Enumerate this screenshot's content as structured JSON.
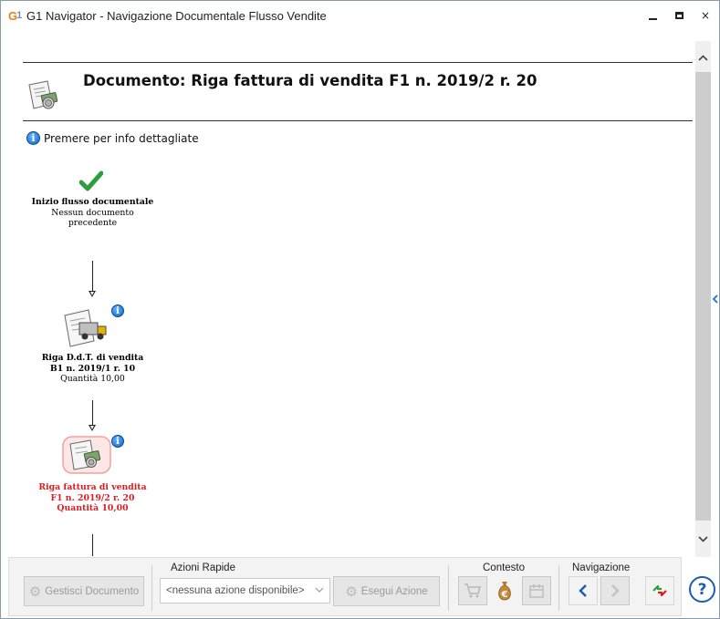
{
  "window": {
    "app_logo": "G1",
    "title": "G1 Navigator - Navigazione Documentale Flusso Vendite",
    "minimize_icon": "minimize-icon",
    "maximize_icon": "maximize-icon",
    "close_label": "×"
  },
  "header": {
    "title": "Documento: Riga fattura di vendita F1 n. 2019/2 r. 20",
    "icon": "invoice-document-icon"
  },
  "info_hint": {
    "icon_glyph": "i",
    "text": "Premere per info dettagliate"
  },
  "flow": {
    "start": {
      "icon": "checkmark-icon",
      "name": "Inizio flusso documentale",
      "lines": [
        "Nessun documento",
        "precedente"
      ]
    },
    "nodes": [
      {
        "icon": "delivery-truck-document-icon",
        "info_glyph": "i",
        "name": "Riga D.d.T. di vendita",
        "ref": "B1 n. 2019/1 r. 10",
        "qty": "Quantità 10,00",
        "current": false
      },
      {
        "icon": "invoice-document-icon",
        "info_glyph": "i",
        "name": "Riga fattura di vendita",
        "ref": "F1 n. 2019/2 r. 20",
        "qty": "Quantità 10,00",
        "current": true,
        "highlight_color": "#e11b22"
      }
    ]
  },
  "toolbar": {
    "manage_button": "Gestisci Documento",
    "azioni_label": "Azioni Rapide",
    "combo_value": "<nessuna azione disponibile>",
    "execute_button": "Esegui Azione",
    "contesto_label": "Contesto",
    "navigazione_label": "Navigazione",
    "help_glyph": "?"
  },
  "colors": {
    "accent_blue": "#1c5fa8",
    "current_red": "#e11b22",
    "check_green": "#2e9e3c"
  }
}
